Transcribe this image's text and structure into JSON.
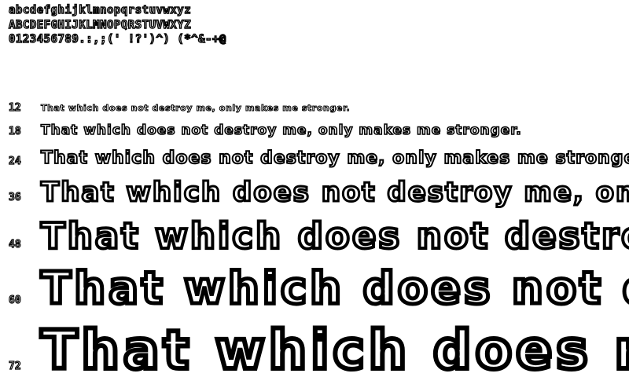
{
  "charset": {
    "lowercase": "abcdefghijklmnopqrstuvwxyz",
    "uppercase": "ABCDEFGHIJKLMNOPQRSTUVWXYZ",
    "digits_symbols": "0123456789.:,;(' !?')^) (*^&-+@"
  },
  "samples": [
    {
      "size": "12",
      "text": "That which does not destroy me, only makes me stronger."
    },
    {
      "size": "18",
      "text": "That which does not destroy me, only makes me stronger."
    },
    {
      "size": "24",
      "text": "That which does not destroy me, only makes me stronger."
    },
    {
      "size": "36",
      "text": "That which does not destroy me, only makes me stronger."
    },
    {
      "size": "48",
      "text": "That which does not destroy me, only makes me stronger."
    },
    {
      "size": "60",
      "text": "That which does not destroy me, only makes me stronger."
    },
    {
      "size": "72",
      "text": "That which does not destroy me, only makes me stronger."
    }
  ],
  "colors": {
    "background": "#ffffff",
    "ink": "#000000"
  }
}
